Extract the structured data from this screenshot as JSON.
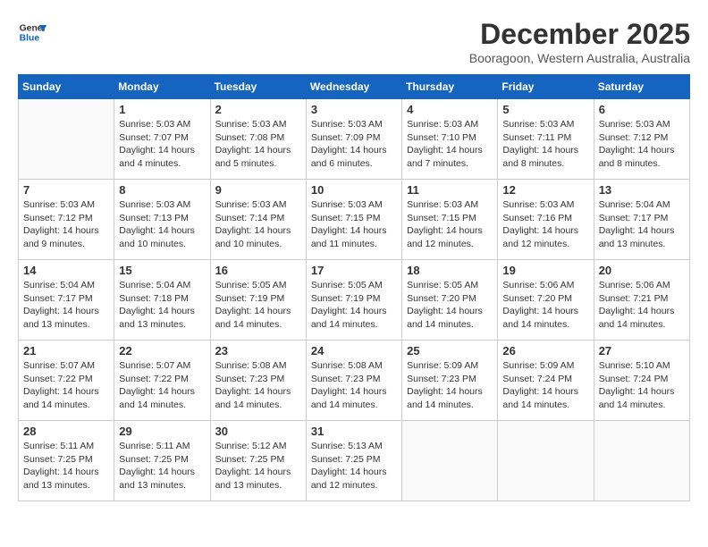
{
  "header": {
    "logo_line1": "General",
    "logo_line2": "Blue",
    "month": "December 2025",
    "location": "Booragoon, Western Australia, Australia"
  },
  "weekdays": [
    "Sunday",
    "Monday",
    "Tuesday",
    "Wednesday",
    "Thursday",
    "Friday",
    "Saturday"
  ],
  "weeks": [
    [
      {
        "day": "",
        "info": ""
      },
      {
        "day": "1",
        "info": "Sunrise: 5:03 AM\nSunset: 7:07 PM\nDaylight: 14 hours\nand 4 minutes."
      },
      {
        "day": "2",
        "info": "Sunrise: 5:03 AM\nSunset: 7:08 PM\nDaylight: 14 hours\nand 5 minutes."
      },
      {
        "day": "3",
        "info": "Sunrise: 5:03 AM\nSunset: 7:09 PM\nDaylight: 14 hours\nand 6 minutes."
      },
      {
        "day": "4",
        "info": "Sunrise: 5:03 AM\nSunset: 7:10 PM\nDaylight: 14 hours\nand 7 minutes."
      },
      {
        "day": "5",
        "info": "Sunrise: 5:03 AM\nSunset: 7:11 PM\nDaylight: 14 hours\nand 8 minutes."
      },
      {
        "day": "6",
        "info": "Sunrise: 5:03 AM\nSunset: 7:12 PM\nDaylight: 14 hours\nand 8 minutes."
      }
    ],
    [
      {
        "day": "7",
        "info": "Sunrise: 5:03 AM\nSunset: 7:12 PM\nDaylight: 14 hours\nand 9 minutes."
      },
      {
        "day": "8",
        "info": "Sunrise: 5:03 AM\nSunset: 7:13 PM\nDaylight: 14 hours\nand 10 minutes."
      },
      {
        "day": "9",
        "info": "Sunrise: 5:03 AM\nSunset: 7:14 PM\nDaylight: 14 hours\nand 10 minutes."
      },
      {
        "day": "10",
        "info": "Sunrise: 5:03 AM\nSunset: 7:15 PM\nDaylight: 14 hours\nand 11 minutes."
      },
      {
        "day": "11",
        "info": "Sunrise: 5:03 AM\nSunset: 7:15 PM\nDaylight: 14 hours\nand 12 minutes."
      },
      {
        "day": "12",
        "info": "Sunrise: 5:03 AM\nSunset: 7:16 PM\nDaylight: 14 hours\nand 12 minutes."
      },
      {
        "day": "13",
        "info": "Sunrise: 5:04 AM\nSunset: 7:17 PM\nDaylight: 14 hours\nand 13 minutes."
      }
    ],
    [
      {
        "day": "14",
        "info": "Sunrise: 5:04 AM\nSunset: 7:17 PM\nDaylight: 14 hours\nand 13 minutes."
      },
      {
        "day": "15",
        "info": "Sunrise: 5:04 AM\nSunset: 7:18 PM\nDaylight: 14 hours\nand 13 minutes."
      },
      {
        "day": "16",
        "info": "Sunrise: 5:05 AM\nSunset: 7:19 PM\nDaylight: 14 hours\nand 14 minutes."
      },
      {
        "day": "17",
        "info": "Sunrise: 5:05 AM\nSunset: 7:19 PM\nDaylight: 14 hours\nand 14 minutes."
      },
      {
        "day": "18",
        "info": "Sunrise: 5:05 AM\nSunset: 7:20 PM\nDaylight: 14 hours\nand 14 minutes."
      },
      {
        "day": "19",
        "info": "Sunrise: 5:06 AM\nSunset: 7:20 PM\nDaylight: 14 hours\nand 14 minutes."
      },
      {
        "day": "20",
        "info": "Sunrise: 5:06 AM\nSunset: 7:21 PM\nDaylight: 14 hours\nand 14 minutes."
      }
    ],
    [
      {
        "day": "21",
        "info": "Sunrise: 5:07 AM\nSunset: 7:22 PM\nDaylight: 14 hours\nand 14 minutes."
      },
      {
        "day": "22",
        "info": "Sunrise: 5:07 AM\nSunset: 7:22 PM\nDaylight: 14 hours\nand 14 minutes."
      },
      {
        "day": "23",
        "info": "Sunrise: 5:08 AM\nSunset: 7:23 PM\nDaylight: 14 hours\nand 14 minutes."
      },
      {
        "day": "24",
        "info": "Sunrise: 5:08 AM\nSunset: 7:23 PM\nDaylight: 14 hours\nand 14 minutes."
      },
      {
        "day": "25",
        "info": "Sunrise: 5:09 AM\nSunset: 7:23 PM\nDaylight: 14 hours\nand 14 minutes."
      },
      {
        "day": "26",
        "info": "Sunrise: 5:09 AM\nSunset: 7:24 PM\nDaylight: 14 hours\nand 14 minutes."
      },
      {
        "day": "27",
        "info": "Sunrise: 5:10 AM\nSunset: 7:24 PM\nDaylight: 14 hours\nand 14 minutes."
      }
    ],
    [
      {
        "day": "28",
        "info": "Sunrise: 5:11 AM\nSunset: 7:25 PM\nDaylight: 14 hours\nand 13 minutes."
      },
      {
        "day": "29",
        "info": "Sunrise: 5:11 AM\nSunset: 7:25 PM\nDaylight: 14 hours\nand 13 minutes."
      },
      {
        "day": "30",
        "info": "Sunrise: 5:12 AM\nSunset: 7:25 PM\nDaylight: 14 hours\nand 13 minutes."
      },
      {
        "day": "31",
        "info": "Sunrise: 5:13 AM\nSunset: 7:25 PM\nDaylight: 14 hours\nand 12 minutes."
      },
      {
        "day": "",
        "info": ""
      },
      {
        "day": "",
        "info": ""
      },
      {
        "day": "",
        "info": ""
      }
    ]
  ]
}
